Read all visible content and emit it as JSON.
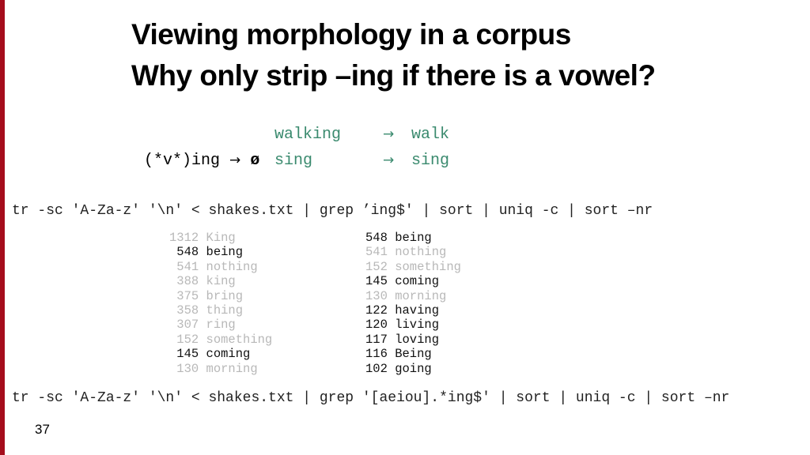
{
  "slide": {
    "title_lines": [
      "Viewing morphology in a corpus",
      "Why only strip –ing if there is a vowel?"
    ],
    "rule": {
      "pattern": "(*v*)ing",
      "arrow": "→",
      "result": "ø",
      "examples": [
        {
          "input": "walking",
          "arrow": "→",
          "output": "walk"
        },
        {
          "input": "sing",
          "arrow": "→",
          "output": "sing"
        }
      ]
    },
    "command1": "tr -sc 'A-Za-z' '\\n' < shakes.txt | grep ’ing$' | sort | uniq -c | sort –nr",
    "command2": "tr -sc 'A-Za-z' '\\n' < shakes.txt | grep '[aeiou].*ing$' | sort | uniq -c | sort –nr",
    "results_left": [
      {
        "count": "1312",
        "word": "King",
        "highlight": false
      },
      {
        "count": "548",
        "word": "being",
        "highlight": true
      },
      {
        "count": "541",
        "word": "nothing",
        "highlight": false
      },
      {
        "count": "388",
        "word": "king",
        "highlight": false
      },
      {
        "count": "375",
        "word": "bring",
        "highlight": false
      },
      {
        "count": "358",
        "word": "thing",
        "highlight": false
      },
      {
        "count": "307",
        "word": "ring",
        "highlight": false
      },
      {
        "count": "152",
        "word": "something",
        "highlight": false
      },
      {
        "count": "145",
        "word": "coming",
        "highlight": true
      },
      {
        "count": "130",
        "word": "morning",
        "highlight": false
      }
    ],
    "results_right": [
      {
        "count": "548",
        "word": "being",
        "highlight": true
      },
      {
        "count": "541",
        "word": "nothing",
        "highlight": false
      },
      {
        "count": "152",
        "word": "something",
        "highlight": false
      },
      {
        "count": "145",
        "word": "coming",
        "highlight": true
      },
      {
        "count": "130",
        "word": "morning",
        "highlight": false
      },
      {
        "count": "122",
        "word": "having",
        "highlight": true
      },
      {
        "count": "120",
        "word": "living",
        "highlight": true
      },
      {
        "count": "117",
        "word": "loving",
        "highlight": true
      },
      {
        "count": "116",
        "word": "Being",
        "highlight": true
      },
      {
        "count": "102",
        "word": "going",
        "highlight": true
      }
    ],
    "slide_number": "37",
    "colors": {
      "accent_bar": "#a50d1c",
      "example_green": "#3a8a6e",
      "dim_text": "#b8b8b8"
    }
  }
}
